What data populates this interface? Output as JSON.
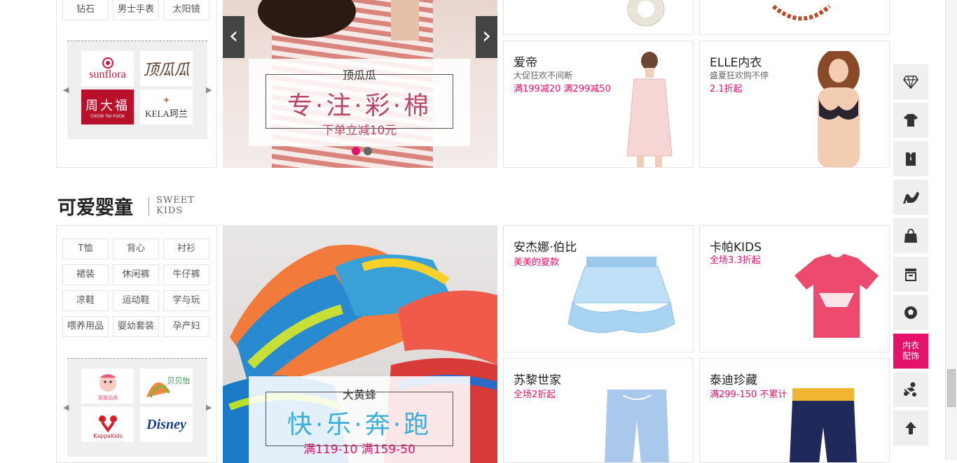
{
  "top_section": {
    "tags": [
      "钻石",
      "男士手表",
      "太阳镜"
    ],
    "brands": [
      "sunflora 桑扶兰",
      "顶瓜瓜",
      "周大福 CHOW TAI FOOK",
      "KELA珂兰"
    ],
    "banner": {
      "brand": "顶瓜瓜",
      "headline": "专·注·彩·棉",
      "sub": "下单立减10元",
      "prev": "‹",
      "next": "›"
    },
    "cards": [
      {
        "title": "爱帝",
        "desc": "大促狂欢不间断",
        "promo": "满199减20 满299减50"
      },
      {
        "title": "ELLE内衣",
        "desc": "盛夏狂欢购不停",
        "promo": "2.1折起"
      }
    ]
  },
  "kids_section": {
    "title": "可爱婴童",
    "title_en_1": "SWEET",
    "title_en_2": "KIDS",
    "tags": [
      "T恤",
      "背心",
      "衬衫",
      "裙装",
      "休闲裤",
      "牛仔裤",
      "凉鞋",
      "运动鞋",
      "学与玩",
      "喂养用品",
      "婴幼套装",
      "孕产妇"
    ],
    "brands": [
      "巴拉巴拉",
      "贝贝怡",
      "Kappa Kids",
      "Disney"
    ],
    "banner": {
      "brand": "大黄蜂",
      "headline": "快·乐·奔·跑",
      "sub": "满119-10 满159-50"
    },
    "cards": [
      {
        "title": "安杰娜·伯比",
        "promo": "美美的夏款"
      },
      {
        "title": "卡帕KIDS",
        "promo": "全场3.3折起"
      },
      {
        "title": "苏黎世家",
        "promo": "全场2折起"
      },
      {
        "title": "泰迪珍藏",
        "promo": "满299-150 不累计"
      }
    ]
  },
  "float_nav": {
    "items": [
      "diamond-icon",
      "tshirt-icon",
      "suit-icon",
      "high-heel-icon",
      "bag-icon",
      "home-icon",
      "soccer-ball-icon",
      "内衣配饰",
      "baby-icon",
      "back-to-top-icon"
    ],
    "active_label_1": "内衣",
    "active_label_2": "配饰",
    "accent": "#e4126b"
  },
  "colors": {
    "accent": "#e4126b",
    "border": "#e5e5e5",
    "panel_bg": "#efefef"
  }
}
